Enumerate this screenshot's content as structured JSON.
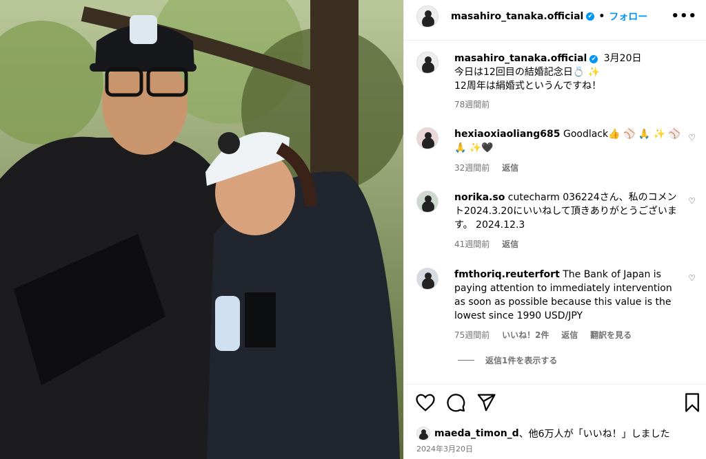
{
  "post": {
    "username": "masahiro_tanaka.official",
    "verified_mark": "✔",
    "dot": "•",
    "follow_label": "フォロー",
    "more_label": "•••",
    "caption_date": "3月20日",
    "caption_line1": "今日は12回目の結婚記念日💍 ✨",
    "caption_line2": "12周年は絹婚式というんですね！",
    "caption_age": "78週間前"
  },
  "comments": [
    {
      "username": "hexiaoxiaoliang685",
      "text": "Goodlack👍 ⚾ 🙏 ✨ ⚾ 🙏 ✨🖤",
      "age": "32週間前",
      "reply": "返信"
    },
    {
      "username": "norika.so",
      "text": "cutecharm 036224さん、私のコメント2024.3.20にいいねして頂きありがとうございます。 2024.12.3",
      "age": "41週間前",
      "reply": "返信"
    },
    {
      "username": "fmthoriq.reuterfort",
      "text": "The Bank of Japan is paying attention to immediately intervention as soon as possible because this value is the lowest since 1990 USD/JPY",
      "age": "75週間前",
      "likes": "いいね！2件",
      "reply": "返信",
      "translate": "翻訳を見る"
    }
  ],
  "view_replies": "返信1件を表示する",
  "likes": {
    "user": "maeda_timon_d",
    "rest": "、他6万人が「いいね！」しました"
  },
  "post_date": "2024年3月20日",
  "icons": [
    "heart-icon",
    "comment-icon",
    "share-icon",
    "bookmark-icon",
    "more-icon"
  ],
  "colors": {
    "accent": "#0095f6",
    "muted": "#737373"
  }
}
